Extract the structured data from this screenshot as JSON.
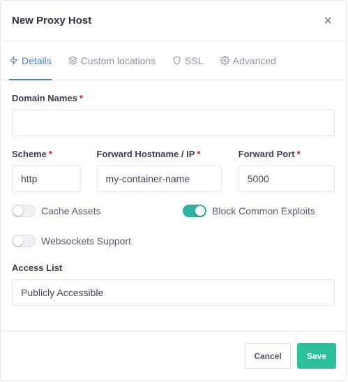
{
  "dialog": {
    "title": "New Proxy Host",
    "close_label": "×"
  },
  "tabs": [
    {
      "label": "Details",
      "icon": "lightning-icon",
      "active": true
    },
    {
      "label": "Custom locations",
      "icon": "layers-icon",
      "active": false
    },
    {
      "label": "SSL",
      "icon": "shield-icon",
      "active": false
    },
    {
      "label": "Advanced",
      "icon": "gear-icon",
      "active": false
    }
  ],
  "form": {
    "domain_names": {
      "label": "Domain Names",
      "required_mark": "*",
      "value": ""
    },
    "scheme": {
      "label": "Scheme",
      "required_mark": "*",
      "value": "http"
    },
    "forward_host": {
      "label": "Forward Hostname / IP",
      "required_mark": "*",
      "value": "my-container-name"
    },
    "forward_port": {
      "label": "Forward Port",
      "required_mark": "*",
      "value": "5000"
    },
    "cache_assets": {
      "label": "Cache Assets",
      "enabled": false
    },
    "block_exploits": {
      "label": "Block Common Exploits",
      "enabled": true
    },
    "websockets": {
      "label": "Websockets Support",
      "enabled": false
    },
    "access_list": {
      "label": "Access List",
      "value": "Publicly Accessible"
    }
  },
  "footer": {
    "cancel_label": "Cancel",
    "save_label": "Save"
  },
  "colors": {
    "accent": "#467fcf",
    "toggle_on": "#2fb39e",
    "save_button": "#2bbf9e",
    "required": "#cd201f"
  }
}
